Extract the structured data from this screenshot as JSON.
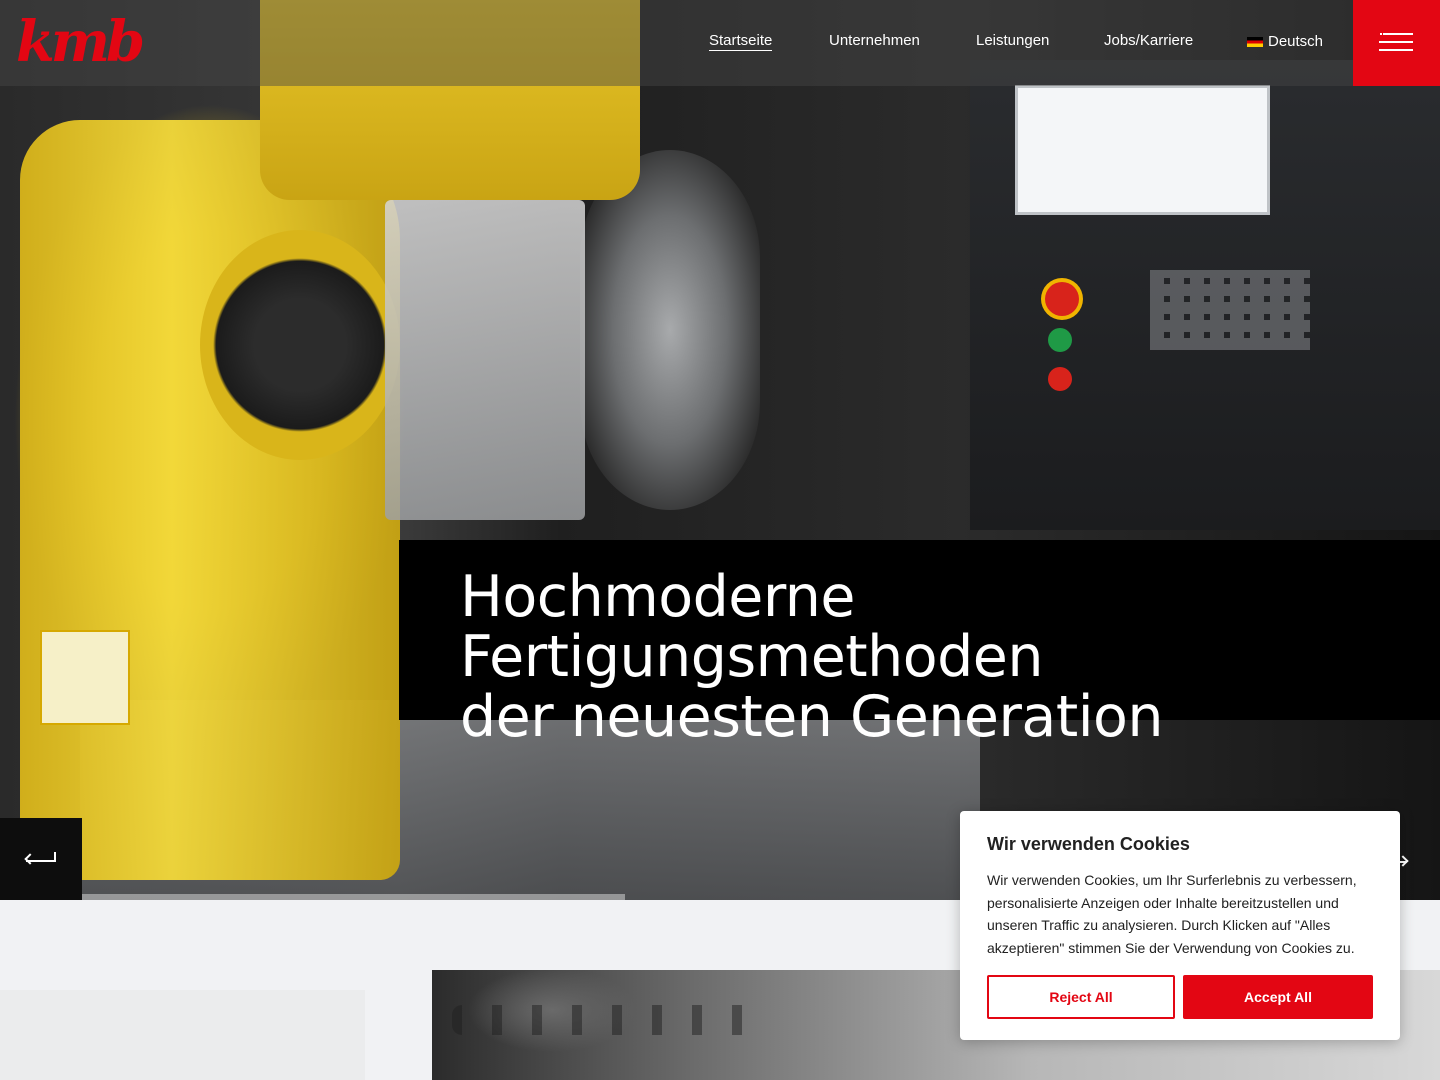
{
  "brand": {
    "logo_text": "kmb",
    "accent_color": "#e30613"
  },
  "nav": {
    "items": [
      {
        "label": "Startseite",
        "active": true
      },
      {
        "label": "Unternehmen",
        "active": false
      },
      {
        "label": "Leistungen",
        "active": false
      },
      {
        "label": "Jobs/Karriere",
        "active": false
      }
    ],
    "language": {
      "label": "Deutsch",
      "flag_icon": "flag-de-icon"
    },
    "menu_icon": "hamburger-menu-icon"
  },
  "hero": {
    "headline_line1": "Hochmoderne Fertigungsmethoden",
    "headline_line2": "der neuesten Generation",
    "prev_icon": "arrow-left-icon",
    "next_icon": "arrow-right-icon",
    "slide_progress": 0.4
  },
  "cookie_banner": {
    "title": "Wir verwenden Cookies",
    "body": "Wir verwenden Cookies, um Ihr Surferlebnis zu verbessern, personalisierte Anzeigen oder Inhalte bereitzustellen und unseren Traffic zu analysieren. Durch Klicken auf \"Alles akzeptieren\" stimmen Sie der Verwendung von Cookies zu.",
    "reject_label": "Reject All",
    "accept_label": "Accept All"
  }
}
